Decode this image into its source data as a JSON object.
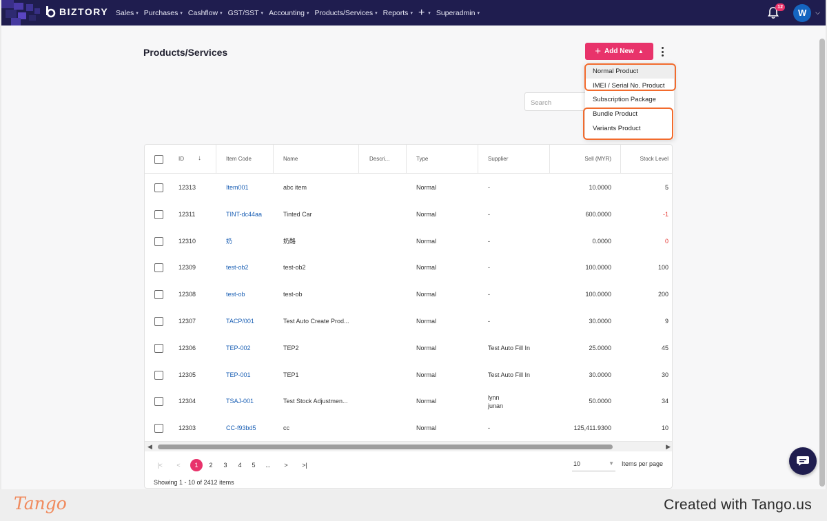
{
  "app": {
    "brand": "BIZTORY"
  },
  "nav": {
    "menu": [
      {
        "label": "Sales",
        "caret": "▾"
      },
      {
        "label": "Purchases",
        "caret": "▾"
      },
      {
        "label": "Cashflow",
        "caret": "▾"
      },
      {
        "label": "GST/SST",
        "caret": "▾"
      },
      {
        "label": "Accounting",
        "caret": "▾"
      },
      {
        "label": "Products/Services",
        "caret": "▾"
      },
      {
        "label": "Reports",
        "caret": "▾"
      },
      {
        "label": "+",
        "caret": "▾"
      },
      {
        "label": "Superadmin",
        "caret": "▾"
      }
    ],
    "notification_count": "12",
    "avatar_initial": "W"
  },
  "page": {
    "title": "Products/Services",
    "add_button": "Add New",
    "search_placeholder": "Search"
  },
  "add_menu": {
    "items": [
      "Normal Product",
      "IMEI / Serial No. Product",
      "Subscription Package",
      "Bundle Product",
      "Variants Product"
    ],
    "hover_index": 0
  },
  "table": {
    "columns": [
      "ID",
      "Item Code",
      "Name",
      "Descri...",
      "Type",
      "Supplier",
      "Sell (MYR)",
      "Stock Level"
    ],
    "rows": [
      {
        "id": "12313",
        "code": "Item001",
        "name": "abc item",
        "type": "Normal",
        "supplier": "-",
        "supplier2": "",
        "sell": "10.0000",
        "stock": "5",
        "negative": false
      },
      {
        "id": "12311",
        "code": "TINT-dc44aa",
        "name": "Tinted Car",
        "type": "Normal",
        "supplier": "-",
        "supplier2": "",
        "sell": "600.0000",
        "stock": "-1",
        "negative": true
      },
      {
        "id": "12310",
        "code": "奶",
        "name": "奶酪",
        "type": "Normal",
        "supplier": "-",
        "supplier2": "",
        "sell": "0.0000",
        "stock": "0",
        "negative": true
      },
      {
        "id": "12309",
        "code": "test-ob2",
        "name": "test-ob2",
        "type": "Normal",
        "supplier": "-",
        "supplier2": "",
        "sell": "100.0000",
        "stock": "100",
        "negative": false
      },
      {
        "id": "12308",
        "code": "test-ob",
        "name": "test-ob",
        "type": "Normal",
        "supplier": "-",
        "supplier2": "",
        "sell": "100.0000",
        "stock": "200",
        "negative": false
      },
      {
        "id": "12307",
        "code": "TACP/001",
        "name": "Test Auto Create Prod...",
        "type": "Normal",
        "supplier": "-",
        "supplier2": "",
        "sell": "30.0000",
        "stock": "9",
        "negative": false
      },
      {
        "id": "12306",
        "code": "TEP-002",
        "name": "TEP2",
        "type": "Normal",
        "supplier": "Test Auto Fill In",
        "supplier2": "",
        "sell": "25.0000",
        "stock": "45",
        "negative": false
      },
      {
        "id": "12305",
        "code": "TEP-001",
        "name": "TEP1",
        "type": "Normal",
        "supplier": "Test Auto Fill In",
        "supplier2": "",
        "sell": "30.0000",
        "stock": "30",
        "negative": false
      },
      {
        "id": "12304",
        "code": "TSAJ-001",
        "name": "Test Stock Adjustmen...",
        "type": "Normal",
        "supplier": "lynn",
        "supplier2": "junan",
        "sell": "50.0000",
        "stock": "34",
        "negative": false
      },
      {
        "id": "12303",
        "code": "CC-f93bd5",
        "name": "cc",
        "type": "Normal",
        "supplier": "-",
        "supplier2": "",
        "sell": "125,411.9300",
        "stock": "10",
        "negative": false
      }
    ]
  },
  "pagination": {
    "first": "|<",
    "prev": "<",
    "pages": [
      "1",
      "2",
      "3",
      "4",
      "5"
    ],
    "ellipsis": "...",
    "next": ">",
    "last": ">|",
    "current": "1",
    "per_page": "10",
    "per_page_label": "Items per page",
    "summary": "Showing 1 - 10 of 2412 items"
  },
  "footer": {
    "logo": "Tango",
    "credit": "Created with Tango.us"
  },
  "colors": {
    "nav_bg": "#1f1d4f",
    "accent": "#e8336b",
    "highlight": "#f26b2d",
    "link": "#1a5fb4"
  }
}
